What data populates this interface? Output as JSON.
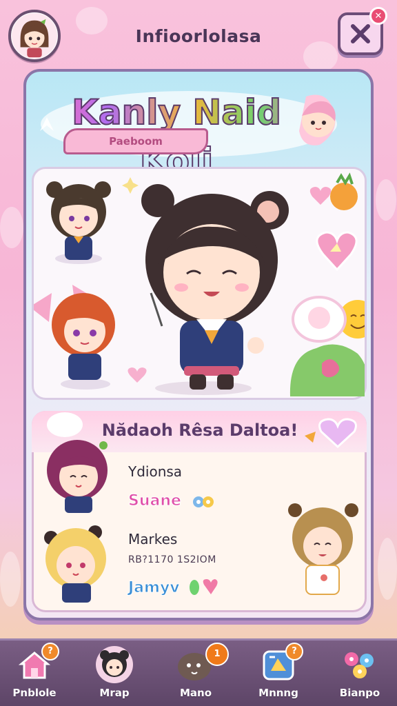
{
  "header": {
    "title": "Infioorlolasa"
  },
  "logo": {
    "title": "Kanly Naid Koli",
    "ribbon": "Paeboom"
  },
  "card": {
    "title": "Nădaoh Rêsa Daltoa!",
    "rows": [
      {
        "label": "Ydionsa"
      },
      {
        "tag": "Suane",
        "tag_color": "#e04fa9"
      },
      {
        "label": "Markes"
      },
      {
        "small": "RB?1170 1S2IOM"
      },
      {
        "tag": "Jamyv",
        "tag_color": "#3c8fd6"
      }
    ]
  },
  "nav": {
    "items": [
      {
        "label": "Pnblole",
        "icon": "home-icon",
        "badge": "?"
      },
      {
        "label": "Mrap",
        "icon": "character-icon"
      },
      {
        "label": "Mano",
        "icon": "pet-icon",
        "badge": "1"
      },
      {
        "label": "Mnnng",
        "icon": "map-icon",
        "badge": "?"
      },
      {
        "label": "Bianpo",
        "icon": "flowers-icon"
      }
    ]
  },
  "colors": {
    "accent_pink": "#ff6fb4",
    "panel_border": "#8b75a8",
    "nav_bg": "#6b5075",
    "badge_orange": "#f08a2b",
    "close_red": "#e94d73"
  }
}
